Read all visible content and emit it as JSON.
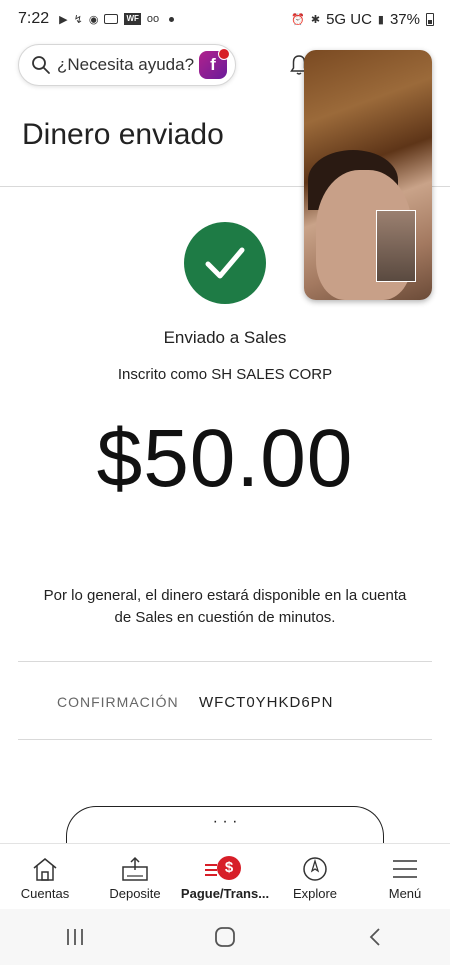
{
  "status_bar": {
    "time": "7:22",
    "network": "5G UC",
    "battery": "37%"
  },
  "help": {
    "placeholder_text": "¿Necesita ayuda?",
    "badge_letter": "f"
  },
  "page": {
    "title": "Dinero enviado"
  },
  "confirmation": {
    "sent_to": "Enviado a Sales",
    "enrolled_as": "Inscrito como SH SALES CORP",
    "amount": "$50.00",
    "availability_line1": "Por lo general, el dinero estará disponible en la cuenta",
    "availability_line2": "de Sales en cuestión de minutos.",
    "confirmation_label": "CONFIRMACIÓN",
    "confirmation_number": "WFCT0YHKD6PN",
    "more_button_label": "· · ·"
  },
  "bottom_nav": {
    "items": [
      {
        "label": "Cuentas",
        "icon": "house-icon"
      },
      {
        "label": "Deposite",
        "icon": "deposit-icon"
      },
      {
        "label": "Pague/Trans...",
        "icon": "pay-transfer-icon"
      },
      {
        "label": "Explore",
        "icon": "compass-icon"
      },
      {
        "label": "Menú",
        "icon": "menu-icon"
      }
    ],
    "active_index": 2
  },
  "colors": {
    "success_green": "#1e7b45",
    "brand_red": "#d71e28"
  }
}
